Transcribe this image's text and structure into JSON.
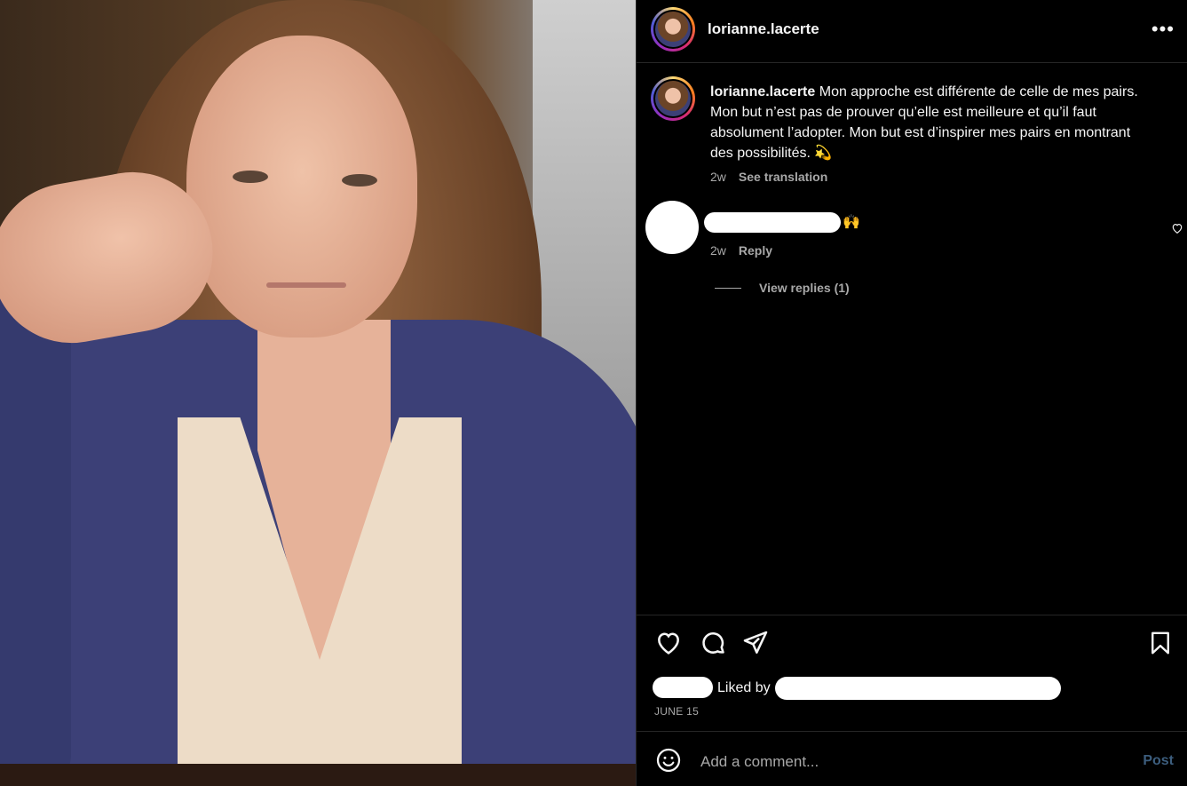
{
  "post": {
    "username": "lorianne.lacerte",
    "more_icon": "more-horizontal-icon",
    "photo_icon": "post-photo"
  },
  "caption": {
    "author": "lorianne.lacerte",
    "text": "Mon approche est différente de celle de mes pairs. Mon but n’est pas de prouver qu’elle est meilleure et qu’il faut absolument l’adopter. Mon but est d’inspirer mes pairs en montrant des possibilités. 💫",
    "age": "2w",
    "see_translation": "See translation"
  },
  "comment": {
    "emoji": "🙌",
    "age": "2w",
    "reply": "Reply",
    "view_replies": "View replies (1)"
  },
  "actions": {
    "like_icon": "heart-icon",
    "comment_icon": "comment-icon",
    "share_icon": "share-icon",
    "save_icon": "bookmark-icon"
  },
  "likes": {
    "liked_by": "Liked by"
  },
  "date": "JUNE 15",
  "comment_input": {
    "placeholder": "Add a comment...",
    "post_label": "Post"
  },
  "colors": {
    "background": "#000000",
    "divider": "#262626",
    "muted_text": "#a8a8a8",
    "post_disabled": "#3c5d7d"
  }
}
